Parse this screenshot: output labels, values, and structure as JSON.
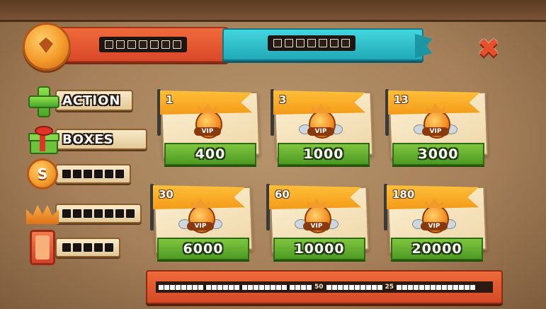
{
  "header": {
    "coin_icon": "gem-coin-icon",
    "left_counter_dots": 7,
    "right_counter_dots": 7,
    "close_symbol": "✖"
  },
  "menu": [
    {
      "id": "action",
      "label": "ACTION",
      "icon": "plus-icon"
    },
    {
      "id": "boxes",
      "label": "BOXES",
      "icon": "gift-icon"
    },
    {
      "id": "coins",
      "label": "",
      "icon": "coin-s-icon",
      "dots": 6,
      "symbol": "S"
    },
    {
      "id": "crown",
      "label": "",
      "icon": "crown-icon",
      "dots": 7
    },
    {
      "id": "card",
      "label": "",
      "icon": "card-icon",
      "dots": 5
    }
  ],
  "vip_tiers": [
    {
      "level": "1",
      "price": "400"
    },
    {
      "level": "3",
      "price": "1000"
    },
    {
      "level": "13",
      "price": "3000"
    },
    {
      "level": "30",
      "price": "6000"
    },
    {
      "level": "60",
      "price": "10000"
    },
    {
      "level": "180",
      "price": "20000"
    }
  ],
  "badge_label": "VIP",
  "bottom_bar": {
    "value_a": "50",
    "value_b": "25"
  },
  "colors": {
    "accent_orange": "#e8562c",
    "accent_blue": "#2bb8c4",
    "price_green": "#5ca82a",
    "flag_yellow": "#f5a623"
  }
}
